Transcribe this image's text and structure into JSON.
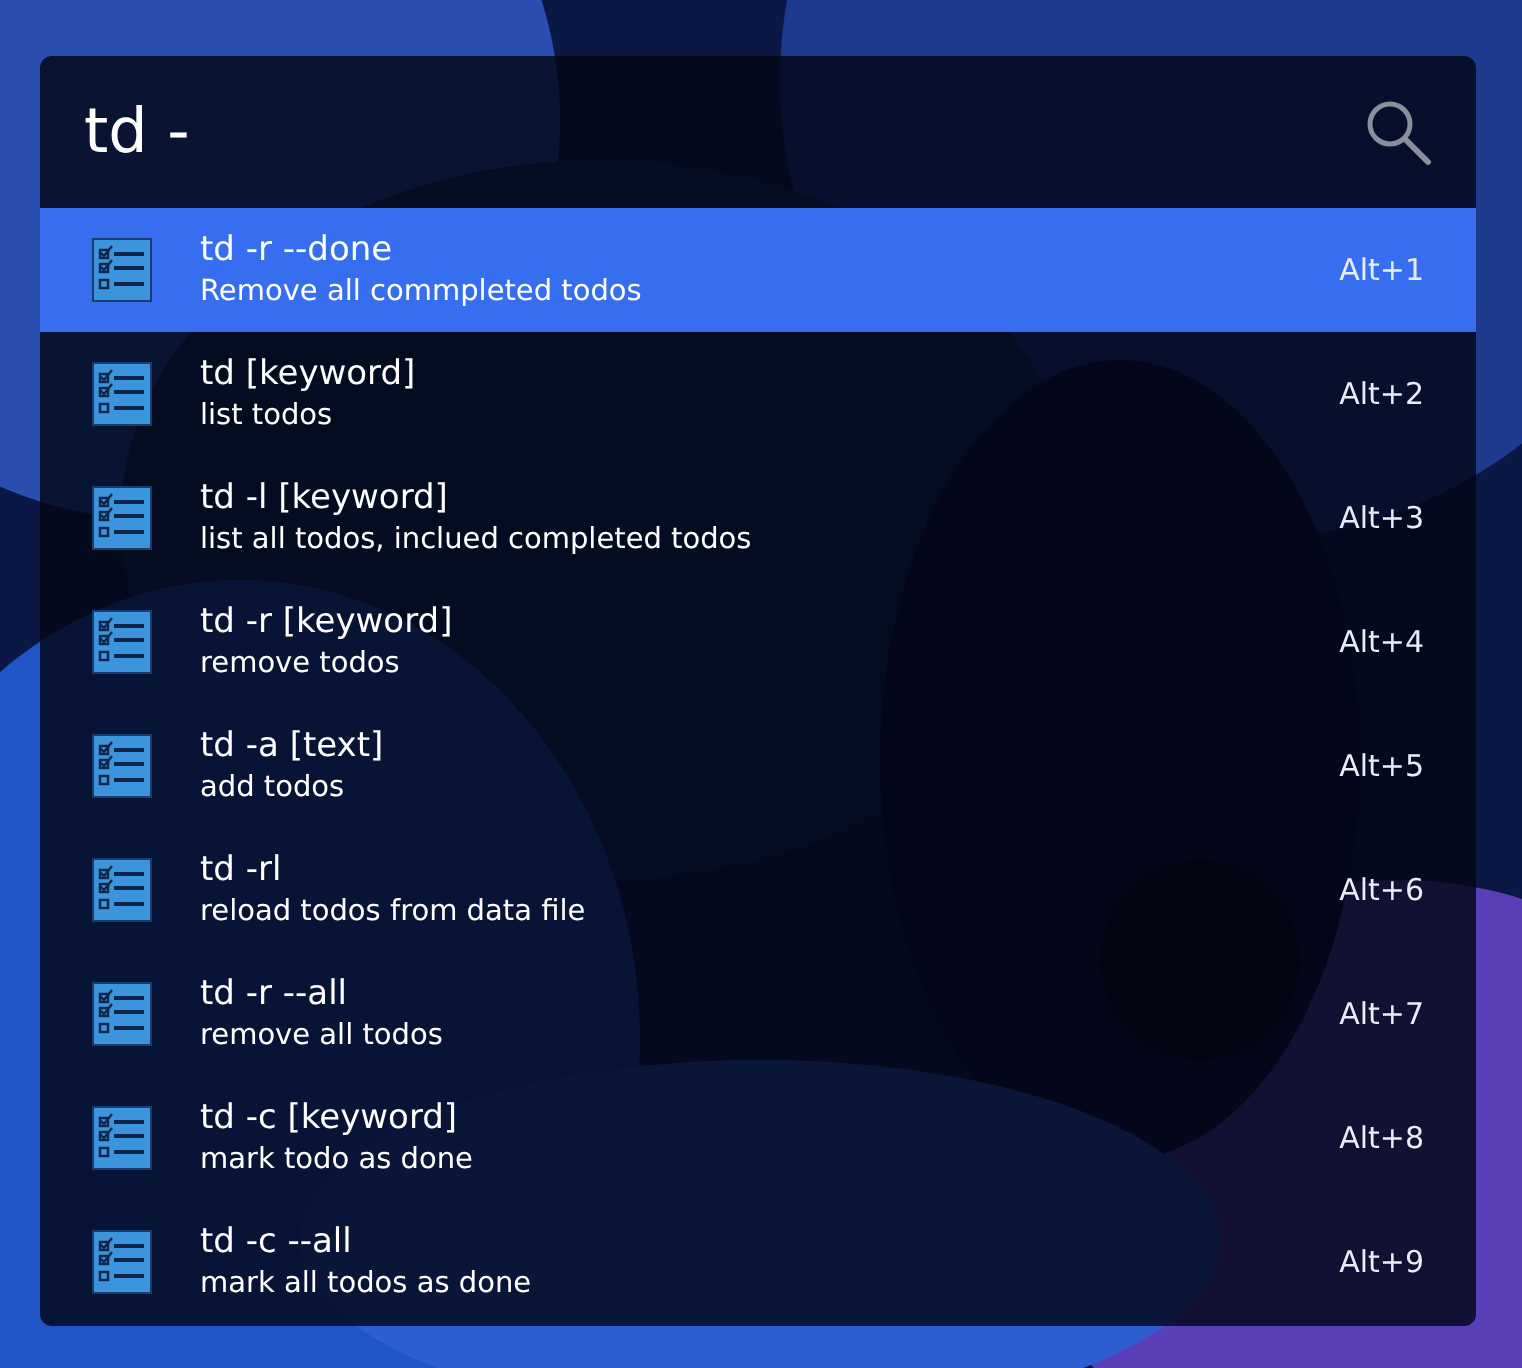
{
  "query": {
    "value": "td -"
  },
  "results": [
    {
      "title": "td -r --done",
      "subtitle": "Remove all commpleted todos",
      "hotkey": "Alt+1",
      "selected": true
    },
    {
      "title": "td [keyword]",
      "subtitle": "list todos",
      "hotkey": "Alt+2",
      "selected": false
    },
    {
      "title": "td -l [keyword]",
      "subtitle": "list all todos, inclued completed todos",
      "hotkey": "Alt+3",
      "selected": false
    },
    {
      "title": "td -r [keyword]",
      "subtitle": "remove todos",
      "hotkey": "Alt+4",
      "selected": false
    },
    {
      "title": "td -a [text]",
      "subtitle": "add todos",
      "hotkey": "Alt+5",
      "selected": false
    },
    {
      "title": "td -rl",
      "subtitle": "reload todos from data file",
      "hotkey": "Alt+6",
      "selected": false
    },
    {
      "title": "td -r --all",
      "subtitle": "remove all todos",
      "hotkey": "Alt+7",
      "selected": false
    },
    {
      "title": "td -c [keyword]",
      "subtitle": "mark todo as done",
      "hotkey": "Alt+8",
      "selected": false
    },
    {
      "title": "td -c --all",
      "subtitle": "mark all todos as done",
      "hotkey": "Alt+9",
      "selected": false
    }
  ]
}
